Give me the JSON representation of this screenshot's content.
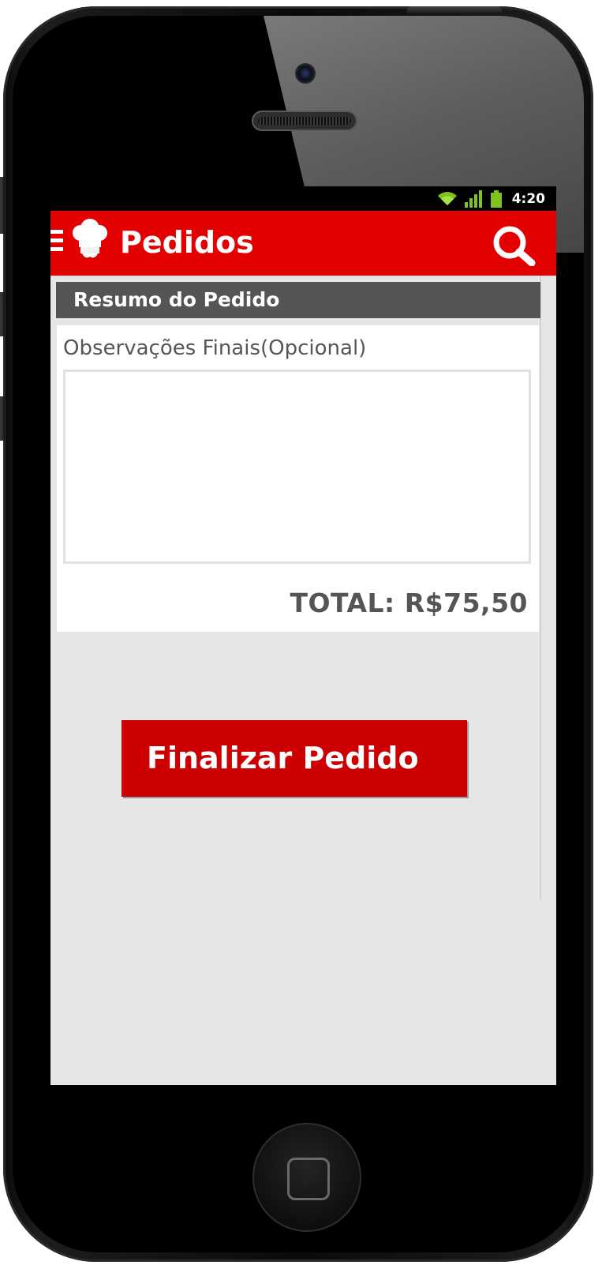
{
  "status_bar": {
    "time": "4:20",
    "icons": [
      "wifi-icon",
      "signal-icon",
      "battery-icon"
    ]
  },
  "app_bar": {
    "title": "Pedidos",
    "logo": "chef-hat-logo",
    "menu_icon": "hamburger-menu-icon",
    "search_icon": "search-icon",
    "color": "#e30000"
  },
  "summary": {
    "header": "Resumo do Pedido",
    "observations_label": "Observações Finais(Opcional)",
    "observations_value": "",
    "total": "TOTAL: R$75,50"
  },
  "actions": {
    "finalize_label": "Finalizar Pedido",
    "color": "#cc0000"
  },
  "colors": {
    "header_bg": "#555555",
    "screen_bg": "#e6e6e6",
    "text_gray": "#555555"
  }
}
